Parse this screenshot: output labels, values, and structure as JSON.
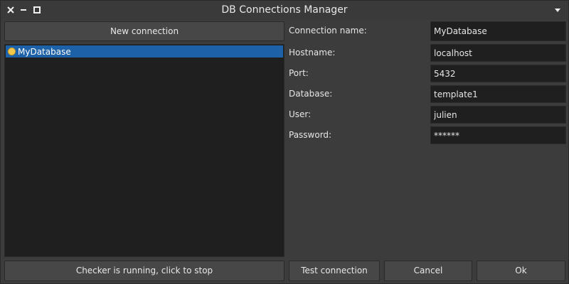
{
  "window": {
    "title": "DB Connections Manager"
  },
  "buttons": {
    "new_connection": "New connection",
    "checker": "Checker is running, click to stop",
    "test_connection": "Test connection",
    "cancel": "Cancel",
    "ok": "Ok"
  },
  "connections": [
    {
      "label": "MyDatabase",
      "status_color": "#f2c94c",
      "selected": true
    }
  ],
  "form": {
    "connection_name": {
      "label": "Connection name:",
      "value": "MyDatabase"
    },
    "hostname": {
      "label": "Hostname:",
      "value": "localhost"
    },
    "port": {
      "label": "Port:",
      "value": "5432"
    },
    "database": {
      "label": "Database:",
      "value": "template1"
    },
    "user": {
      "label": "User:",
      "value": "julien"
    },
    "password": {
      "label": "Password:",
      "value": "******"
    }
  },
  "colors": {
    "background": "#3c3c3c",
    "panel": "#1f1f1f",
    "selection": "#1d61a8",
    "status_dot": "#f2c94c"
  }
}
